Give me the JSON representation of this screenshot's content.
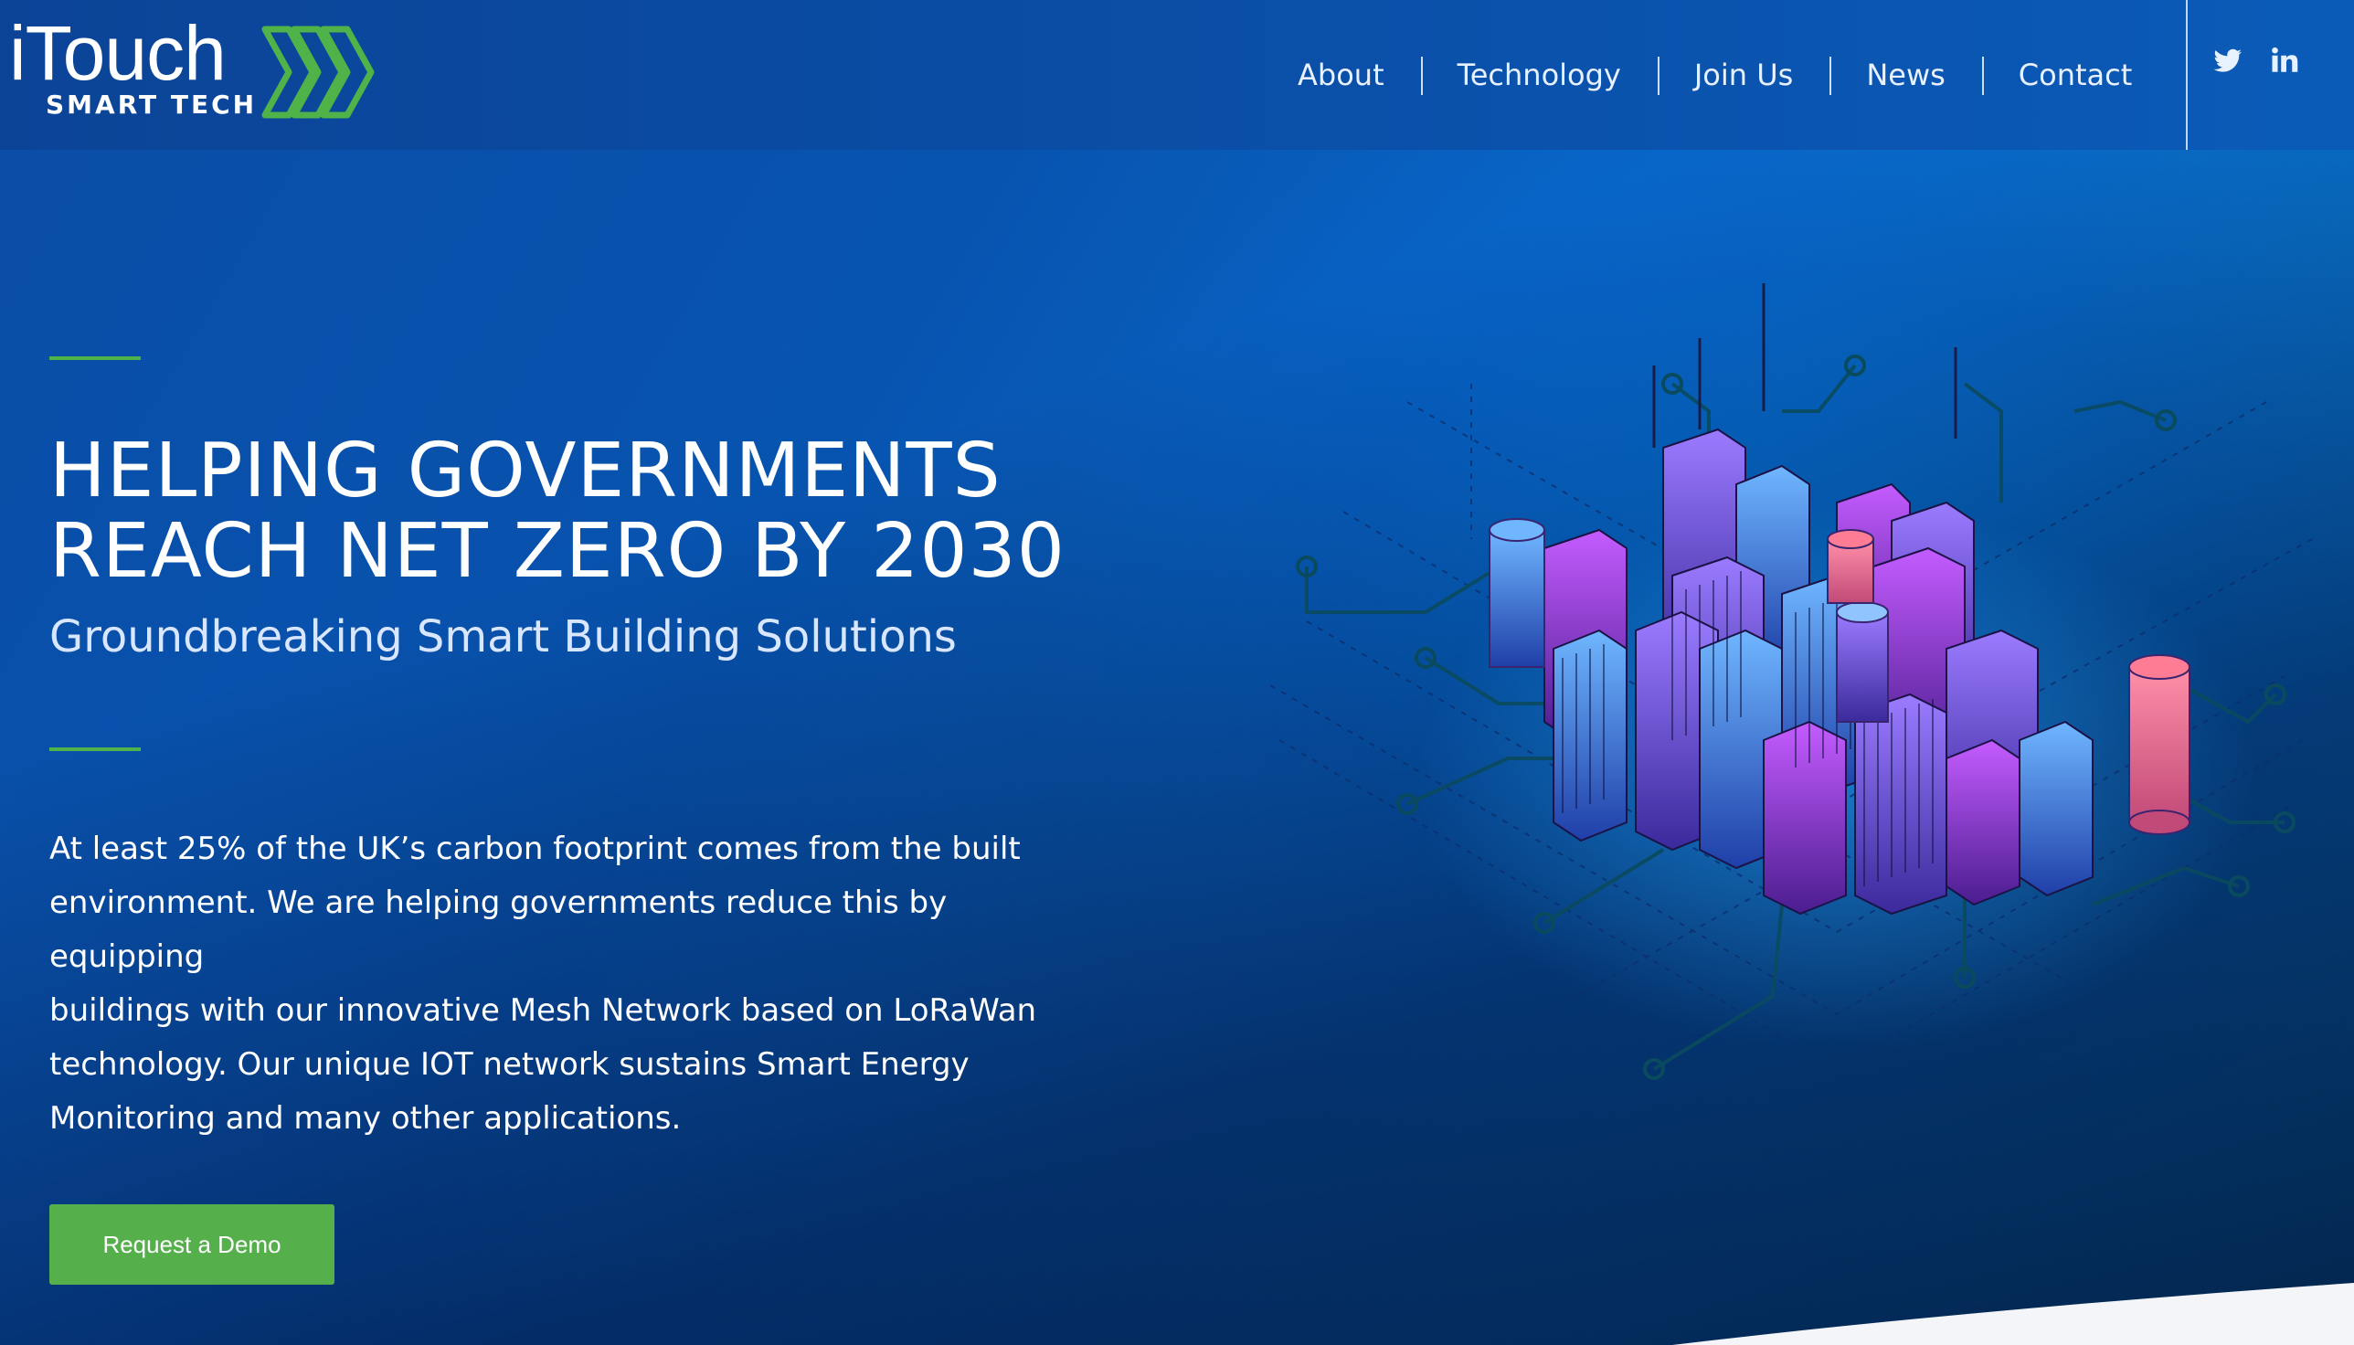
{
  "brand": {
    "name": "iTouch",
    "tagline": "SMART TECH",
    "accent_color": "#4fb34a"
  },
  "nav": {
    "items": [
      {
        "label": "About"
      },
      {
        "label": "Technology"
      },
      {
        "label": "Join Us"
      },
      {
        "label": "News"
      },
      {
        "label": "Contact"
      }
    ],
    "social": [
      "twitter-icon",
      "linkedin-icon"
    ]
  },
  "hero": {
    "title_line1": "HELPING GOVERNMENTS",
    "title_line2": "REACH NET ZERO BY 2030",
    "subtitle": "Groundbreaking Smart Building Solutions",
    "body_lines": [
      "At least 25% of the UK’s carbon footprint comes from the built",
      "environment. We are helping governments reduce this by equipping",
      "buildings with our innovative Mesh Network based on LoRaWan",
      "technology. Our unique IOT network sustains Smart Energy",
      "Monitoring and many other applications."
    ],
    "cta_label": "Request a Demo",
    "cta_color": "#55b04c"
  },
  "illustration": {
    "icon": "isometric-smart-city-icon"
  }
}
